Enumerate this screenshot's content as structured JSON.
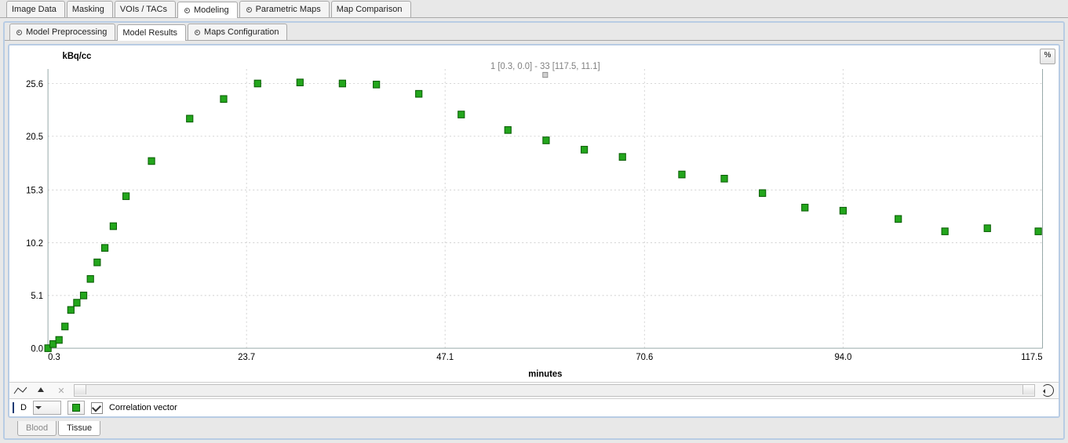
{
  "top_tabs": [
    "Image Data",
    "Masking",
    "VOIs / TACs",
    "Modeling",
    "Parametric Maps",
    "Map Comparison"
  ],
  "top_tab_selected_index": 3,
  "sub_tabs": [
    "Model Preprocessing",
    "Model Results",
    "Maps Configuration"
  ],
  "sub_tab_selected_index": 1,
  "pct_button_label": "%",
  "chart_info_text": "1 [0.3, 0.0] - 33 [117.5, 11.1]",
  "legend": {
    "series_letter": "D",
    "checkbox_checked": true,
    "checkbox_label": "Correlation vector"
  },
  "bottom_tabs": [
    "Blood",
    "Tissue"
  ],
  "bottom_tab_selected_index": 1,
  "chart_data": {
    "type": "scatter",
    "title": "",
    "xlabel": "minutes",
    "ylabel": "kBq/cc",
    "xlim": [
      0.3,
      117.5
    ],
    "ylim": [
      0.0,
      27.0
    ],
    "ytick_values": [
      0.0,
      5.1,
      10.2,
      15.3,
      20.5,
      25.6
    ],
    "xtick_values": [
      0.3,
      23.7,
      47.1,
      70.6,
      94.0,
      117.5
    ],
    "series": [
      {
        "name": "D",
        "marker": "square",
        "color": "#23a61c",
        "x": [
          0.3,
          0.9,
          1.6,
          2.3,
          3.0,
          3.7,
          4.5,
          5.3,
          6.1,
          7.0,
          8.0,
          9.5,
          12.5,
          17.0,
          21.0,
          25.0,
          30.0,
          35.0,
          39.0,
          44.0,
          49.0,
          54.5,
          59.0,
          63.5,
          68.0,
          75.0,
          80.0,
          84.5,
          89.5,
          94.0,
          100.5,
          106.0,
          111.0,
          117.0
        ],
        "y": [
          0.0,
          0.4,
          0.8,
          2.1,
          3.7,
          4.4,
          5.1,
          6.7,
          8.3,
          9.7,
          11.8,
          14.7,
          18.1,
          22.2,
          24.1,
          25.6,
          25.7,
          25.6,
          25.5,
          24.6,
          22.6,
          21.1,
          20.1,
          19.2,
          18.5,
          16.8,
          16.4,
          15.0,
          13.6,
          13.3,
          12.5,
          11.3,
          11.6,
          11.3
        ]
      }
    ]
  }
}
